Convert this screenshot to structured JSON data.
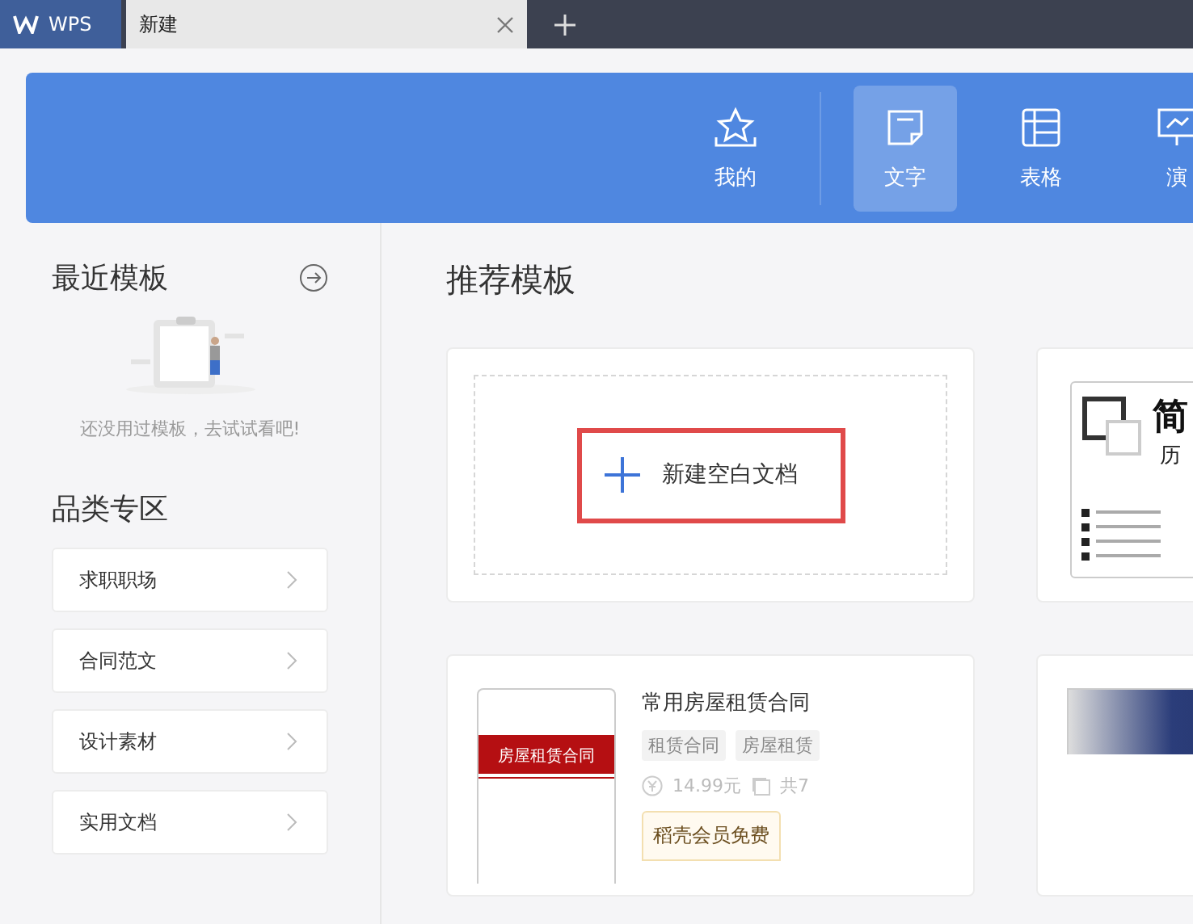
{
  "tabs": [
    {
      "kind": "app",
      "label": "WPS",
      "selected": false
    },
    {
      "kind": "doc",
      "label": "新建",
      "selected": true
    }
  ],
  "nav": [
    {
      "label": "我的",
      "kind": "star",
      "selected": false
    },
    {
      "label": "文字",
      "kind": "doc",
      "selected": true
    },
    {
      "label": "表格",
      "kind": "sheet",
      "selected": false
    },
    {
      "label": "演",
      "kind": "slide",
      "selected": false
    }
  ],
  "recent": {
    "title": "最近模板",
    "empty_text": "还没用过模板，去试试看吧!"
  },
  "categories": {
    "title": "品类专区",
    "items": [
      "求职职场",
      "合同范文",
      "设计素材",
      "实用文档"
    ]
  },
  "main": {
    "title": "推荐模板",
    "new_blank": "新建空白文档",
    "resume_thumb": [
      "简",
      "历"
    ],
    "template": {
      "title": "常用房屋租赁合同",
      "thumb_title": "房屋租赁合同",
      "tags": [
        "租赁合同",
        "房屋租赁"
      ],
      "price": "14.99元",
      "pages": "共7",
      "badge": "稻壳会员免费"
    }
  }
}
